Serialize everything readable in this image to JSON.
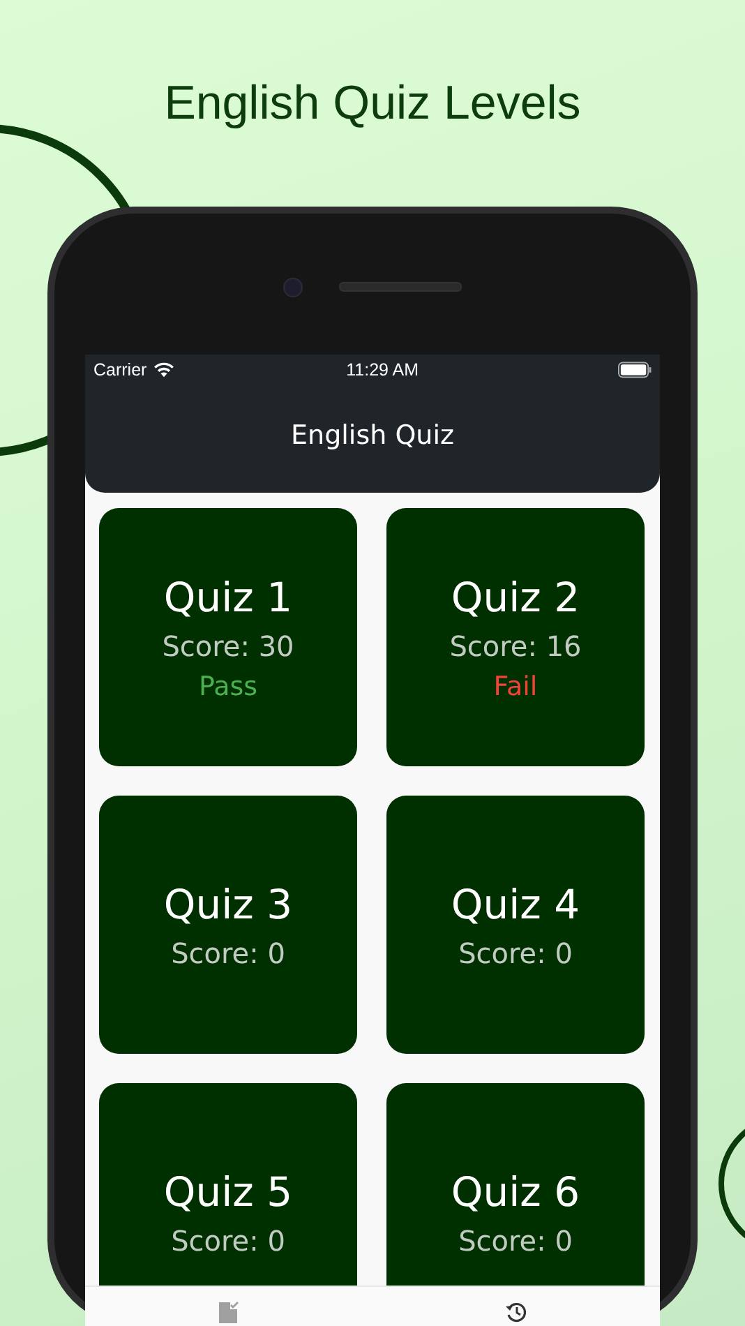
{
  "headline": "English Quiz Levels",
  "status_bar": {
    "carrier": "Carrier",
    "time": "11:29 AM"
  },
  "app_bar": {
    "title": "English Quiz"
  },
  "quizzes": [
    {
      "title": "Quiz 1",
      "score": "Score: 30",
      "result": {
        "text": "Pass",
        "kind": "pass"
      }
    },
    {
      "title": "Quiz 2",
      "score": "Score: 16",
      "result": {
        "text": "Fail",
        "kind": "fail"
      }
    },
    {
      "title": "Quiz 3",
      "score": "Score: 0"
    },
    {
      "title": "Quiz 4",
      "score": "Score: 0"
    },
    {
      "title": "Quiz 5",
      "score": "Score: 0"
    },
    {
      "title": "Quiz 6",
      "score": "Score: 0"
    }
  ],
  "tab_bar": {
    "tabs": [
      {
        "kind": "quiz",
        "selected": true
      },
      {
        "kind": "history",
        "selected": false
      }
    ]
  }
}
